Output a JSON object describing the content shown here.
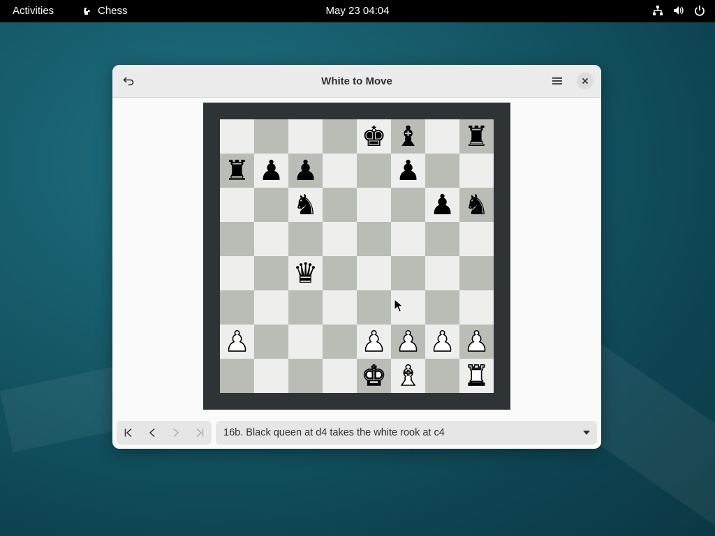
{
  "topbar": {
    "activities": "Activities",
    "app_name": "Chess",
    "clock": "May 23  04:04",
    "icons": [
      "network-icon",
      "volume-icon",
      "power-icon"
    ]
  },
  "window": {
    "title": "White to Move",
    "back_icon": "undo-arrow-icon",
    "menu_icon": "hamburger-menu-icon",
    "close_icon": "close-icon"
  },
  "board": {
    "squares_light": "#eeeeec",
    "squares_dark": "#babdb6",
    "frame": "#2e3436",
    "ranks": [
      [
        "",
        "",
        "",
        "",
        "k",
        "b",
        "",
        "r"
      ],
      [
        "r",
        "p",
        "p",
        "",
        "",
        "p",
        "",
        ""
      ],
      [
        "",
        "",
        "n",
        "",
        "",
        "",
        "p",
        "n"
      ],
      [
        "",
        "",
        "",
        "",
        "",
        "",
        "",
        ""
      ],
      [
        "",
        "",
        "q",
        "",
        "",
        "",
        "",
        ""
      ],
      [
        "",
        "",
        "",
        "",
        "",
        "",
        "",
        ""
      ],
      [
        "P",
        "",
        "",
        "",
        "P",
        "P",
        "P",
        "P"
      ],
      [
        "",
        "",
        "",
        "",
        "K",
        "B",
        "",
        "R"
      ]
    ]
  },
  "history": {
    "buttons": [
      "first-move",
      "previous-move",
      "next-move",
      "last-move"
    ],
    "disabled": [
      "next-move",
      "last-move"
    ],
    "current_move": "16b. Black queen at d4 takes the white rook at c4"
  }
}
